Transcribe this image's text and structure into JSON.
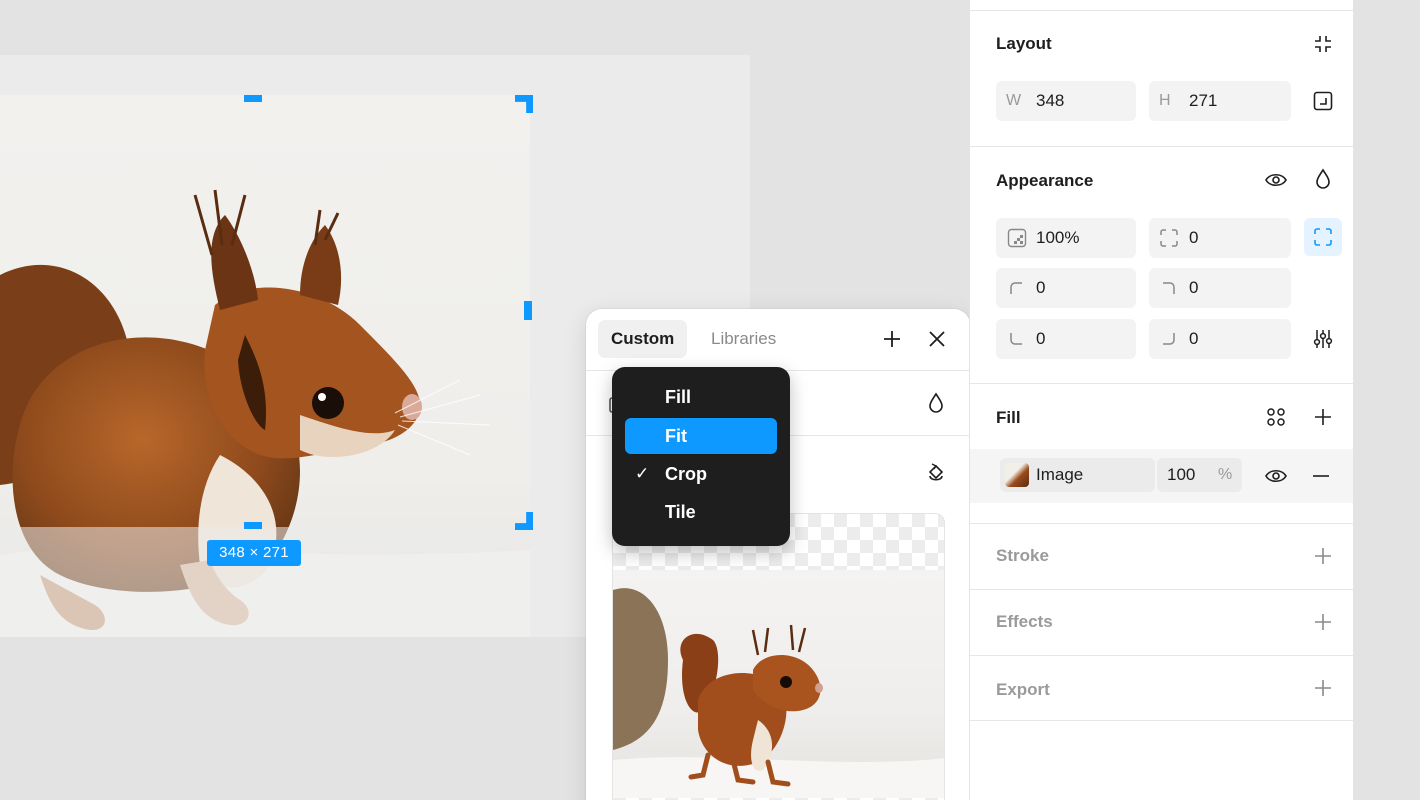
{
  "canvas": {
    "dimension_label": "348 × 271"
  },
  "popover": {
    "tabs": [
      {
        "label": "Custom",
        "active": true
      },
      {
        "label": "Libraries",
        "active": false
      }
    ],
    "add_icon": "plus-icon",
    "close_icon": "close-icon"
  },
  "dropdown": {
    "items": [
      {
        "label": "Fill",
        "checked": false,
        "highlighted": false
      },
      {
        "label": "Fit",
        "checked": false,
        "highlighted": true
      },
      {
        "label": "Crop",
        "checked": true,
        "highlighted": false
      },
      {
        "label": "Tile",
        "checked": false,
        "highlighted": false
      }
    ],
    "check_glyph": "✓"
  },
  "panel": {
    "layout": {
      "title": "Layout",
      "w_label": "W",
      "w_value": "348",
      "h_label": "H",
      "h_value": "271"
    },
    "appearance": {
      "title": "Appearance",
      "opacity": "100%",
      "corner_radius": "0",
      "radius_tl": "0",
      "radius_tr": "0",
      "radius_bl": "0",
      "radius_br": "0"
    },
    "fill": {
      "title": "Fill",
      "type_label": "Image",
      "opacity": "100",
      "opacity_unit": "%"
    },
    "stroke": {
      "title": "Stroke"
    },
    "effects": {
      "title": "Effects"
    },
    "export": {
      "title": "Export"
    }
  },
  "colors": {
    "accent": "#0d99ff",
    "dropdown_bg": "#1e1e1e",
    "canvas_bg": "#e3e3e3"
  }
}
